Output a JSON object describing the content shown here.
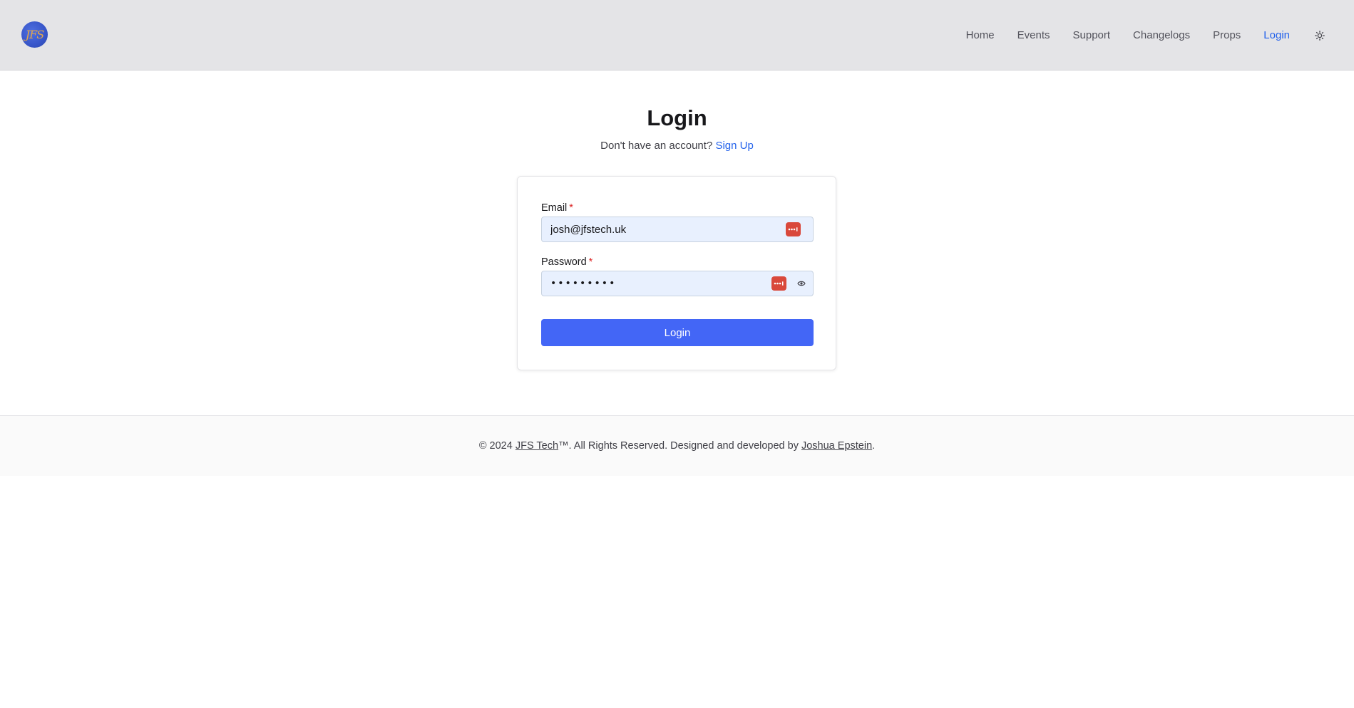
{
  "header": {
    "logo_text": "JFS",
    "nav": [
      {
        "label": "Home",
        "active": false
      },
      {
        "label": "Events",
        "active": false
      },
      {
        "label": "Support",
        "active": false
      },
      {
        "label": "Changelogs",
        "active": false
      },
      {
        "label": "Props",
        "active": false
      },
      {
        "label": "Login",
        "active": true
      }
    ],
    "theme_toggle_icon": "sun-icon"
  },
  "main": {
    "title": "Login",
    "signup_prompt": "Don't have an account?",
    "signup_link": "Sign Up"
  },
  "form": {
    "email_label": "Email",
    "email_required": "*",
    "email_value": "josh@jfstech.uk",
    "password_label": "Password",
    "password_required": "*",
    "password_value": "•••••••••",
    "submit_label": "Login",
    "password_manager_icon": "password-manager-icon",
    "show_password_icon": "eye-icon"
  },
  "footer": {
    "prefix": "© 2024",
    "company_link": "JFS Tech",
    "middle": "™. All Rights Reserved. Designed and developed by",
    "author_link": "Joshua Epstein",
    "suffix": "."
  },
  "colors": {
    "accent": "#2563eb",
    "button": "#4366f6",
    "header_bg": "#e4e4e7",
    "password_manager": "#d9483b",
    "required": "#dc2626"
  }
}
